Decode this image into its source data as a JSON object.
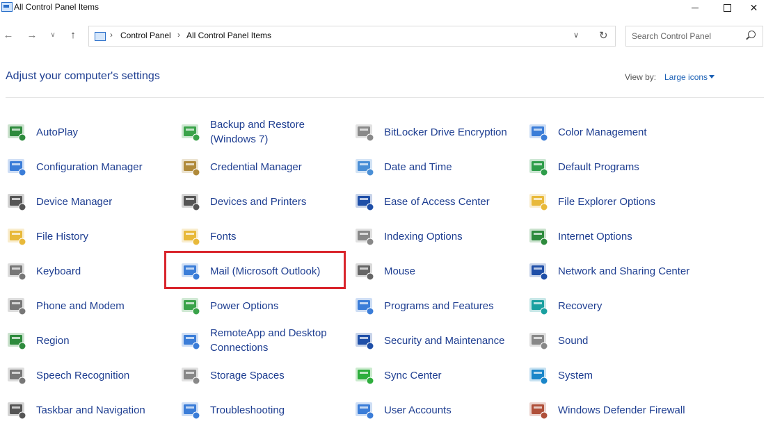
{
  "window": {
    "title": "All Control Panel Items"
  },
  "address": {
    "crumbs": [
      "Control Panel",
      "All Control Panel Items"
    ],
    "separator": "›"
  },
  "search": {
    "placeholder": "Search Control Panel"
  },
  "heading": "Adjust your computer's settings",
  "view_by": {
    "label": "View by:",
    "value": "Large icons"
  },
  "items": [
    {
      "label": "AutoPlay",
      "icon": "autoplay-icon",
      "color": "#2e8b3d"
    },
    {
      "label": "Backup and Restore (Windows 7)",
      "icon": "backup-restore-icon",
      "color": "#3aa34a"
    },
    {
      "label": "BitLocker Drive Encryption",
      "icon": "bitlocker-icon",
      "color": "#8a8a8a"
    },
    {
      "label": "Color Management",
      "icon": "color-management-icon",
      "color": "#3b7dd8"
    },
    {
      "label": "Configuration Manager",
      "icon": "configuration-manager-icon",
      "color": "#3b7dd8"
    },
    {
      "label": "Credential Manager",
      "icon": "credential-manager-icon",
      "color": "#b08a3a"
    },
    {
      "label": "Date and Time",
      "icon": "date-time-icon",
      "color": "#4a8fd6"
    },
    {
      "label": "Default Programs",
      "icon": "default-programs-icon",
      "color": "#2e9d4a"
    },
    {
      "label": "Device Manager",
      "icon": "device-manager-icon",
      "color": "#555555"
    },
    {
      "label": "Devices and Printers",
      "icon": "devices-printers-icon",
      "color": "#555555"
    },
    {
      "label": "Ease of Access Center",
      "icon": "ease-of-access-icon",
      "color": "#1f4fa8"
    },
    {
      "label": "File Explorer Options",
      "icon": "file-explorer-options-icon",
      "color": "#e8b93a"
    },
    {
      "label": "File History",
      "icon": "file-history-icon",
      "color": "#e8b93a"
    },
    {
      "label": "Fonts",
      "icon": "fonts-icon",
      "color": "#e8b93a"
    },
    {
      "label": "Indexing Options",
      "icon": "indexing-options-icon",
      "color": "#888888"
    },
    {
      "label": "Internet Options",
      "icon": "internet-options-icon",
      "color": "#2e8b3d"
    },
    {
      "label": "Keyboard",
      "icon": "keyboard-icon",
      "color": "#777777"
    },
    {
      "label": "Mail (Microsoft Outlook)",
      "icon": "mail-icon",
      "color": "#3b7dd8"
    },
    {
      "label": "Mouse",
      "icon": "mouse-icon",
      "color": "#666666"
    },
    {
      "label": "Network and Sharing Center",
      "icon": "network-sharing-icon",
      "color": "#1f4fa8"
    },
    {
      "label": "Phone and Modem",
      "icon": "phone-modem-icon",
      "color": "#777777"
    },
    {
      "label": "Power Options",
      "icon": "power-options-icon",
      "color": "#3aa34a"
    },
    {
      "label": "Programs and Features",
      "icon": "programs-features-icon",
      "color": "#3b7dd8"
    },
    {
      "label": "Recovery",
      "icon": "recovery-icon",
      "color": "#1aa0a0"
    },
    {
      "label": "Region",
      "icon": "region-icon",
      "color": "#2e8b3d"
    },
    {
      "label": "RemoteApp and Desktop Connections",
      "icon": "remoteapp-icon",
      "color": "#3b7dd8"
    },
    {
      "label": "Security and Maintenance",
      "icon": "security-maintenance-icon",
      "color": "#1f4fa8"
    },
    {
      "label": "Sound",
      "icon": "sound-icon",
      "color": "#888888"
    },
    {
      "label": "Speech Recognition",
      "icon": "speech-recognition-icon",
      "color": "#777777"
    },
    {
      "label": "Storage Spaces",
      "icon": "storage-spaces-icon",
      "color": "#888888"
    },
    {
      "label": "Sync Center",
      "icon": "sync-center-icon",
      "color": "#2eae3d"
    },
    {
      "label": "System",
      "icon": "system-icon",
      "color": "#1a86c9"
    },
    {
      "label": "Taskbar and Navigation",
      "icon": "taskbar-navigation-icon",
      "color": "#555555"
    },
    {
      "label": "Troubleshooting",
      "icon": "troubleshooting-icon",
      "color": "#3b7dd8"
    },
    {
      "label": "User Accounts",
      "icon": "user-accounts-icon",
      "color": "#3b7dd8"
    },
    {
      "label": "Windows Defender Firewall",
      "icon": "firewall-icon",
      "color": "#b0503a"
    }
  ],
  "highlight_color": "#d9252c"
}
